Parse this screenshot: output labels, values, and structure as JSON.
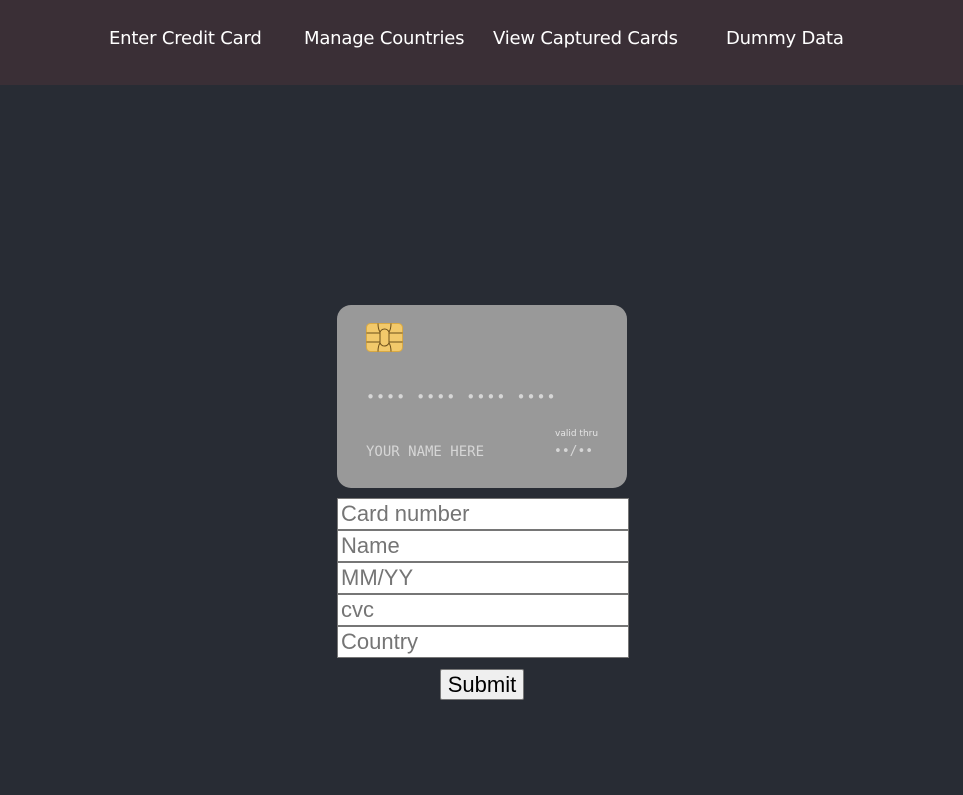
{
  "nav": {
    "items": [
      {
        "label": "Enter Credit Card"
      },
      {
        "label": "Manage Countries"
      },
      {
        "label": "View Captured Cards"
      },
      {
        "label": "Dummy Data"
      }
    ]
  },
  "card_preview": {
    "number_placeholder": "•••• •••• •••• ••••",
    "name_placeholder": "YOUR NAME HERE",
    "valid_thru_label": "valid thru",
    "expiry_placeholder": "••/••",
    "chip_icon": "card-chip-icon"
  },
  "form": {
    "card_number": {
      "value": "",
      "placeholder": "Card number"
    },
    "name": {
      "value": "",
      "placeholder": "Name"
    },
    "expiry": {
      "value": "",
      "placeholder": "MM/YY"
    },
    "cvc": {
      "value": "",
      "placeholder": "cvc"
    },
    "country": {
      "value": "",
      "placeholder": "Country"
    },
    "submit_label": "Submit"
  },
  "colors": {
    "page_background": "#282c34",
    "navbar_background": "#3a2f36",
    "card_background": "#999999",
    "chip_gold": "#f2c96b"
  }
}
